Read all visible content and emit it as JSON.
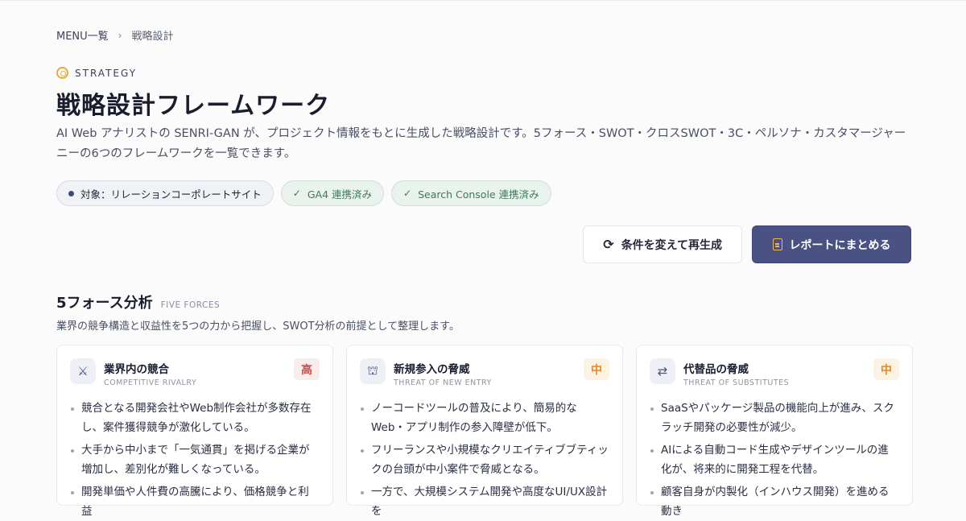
{
  "breadcrumb": {
    "parent": "MENU一覧",
    "separator": "›",
    "current": "戦略設計"
  },
  "eyebrow": {
    "label": "STRATEGY",
    "icon": "target-icon"
  },
  "header": {
    "title": "戦略設計フレームワーク",
    "description": "AI Web アナリストの SENRI-GAN が、プロジェクト情報をもとに生成した戦略設計です。5フォース・SWOT・クロスSWOT・3C・ペルソナ・カスタマージャーニーの6つのフレームワークを一覧できます。"
  },
  "chips": {
    "target": "対象：リレーションコーポレートサイト",
    "ga4": "GA4 連携済み",
    "search_console": "Search Console 連携済み",
    "check_glyph": "✓"
  },
  "actions": {
    "regenerate": {
      "label": "条件を変えて再生成",
      "icon": "refresh-icon",
      "glyph": "⟳"
    },
    "report": {
      "label": "レポートにまとめる",
      "icon": "document-icon"
    }
  },
  "section": {
    "title": "5フォース分析",
    "tag": "FIVE FORCES",
    "description": "業界の競争構造と収益性を5つの力から把握し、SWOT分析の前提として整理します。"
  },
  "cards": [
    {
      "title": "業界内の競合",
      "subtitle": "COMPETITIVE RIVALRY",
      "level": "高",
      "level_type": "high",
      "icon": "crossed-swords-icon",
      "glyph": "⚔",
      "bullets": [
        "競合となる開発会社やWeb制作会社が多数存在し、案件獲得競争が激化している。",
        "大手から中小まで「一気通貫」を掲げる企業が増加し、差別化が難しくなっている。",
        "開発単価や人件費の高騰により、価格競争と利益"
      ]
    },
    {
      "title": "新規参入の脅威",
      "subtitle": "THREAT OF NEW ENTRY",
      "level": "中",
      "level_type": "mid",
      "icon": "building-icon",
      "glyph": "⛫",
      "bullets": [
        "ノーコードツールの普及により、簡易的なWeb・アプリ制作の参入障壁が低下。",
        "フリーランスや小規模なクリエイティブブティックの台頭が中小案件で脅威となる。",
        "一方で、大規模システム開発や高度なUI/UX設計を"
      ]
    },
    {
      "title": "代替品の脅威",
      "subtitle": "THREAT OF SUBSTITUTES",
      "level": "中",
      "level_type": "mid",
      "icon": "swap-icon",
      "glyph": "⇄",
      "bullets": [
        "SaaSやパッケージ製品の機能向上が進み、スクラッチ開発の必要性が減少。",
        "AIによる自動コード生成やデザインツールの進化が、将来的に開発工程を代替。",
        "顧客自身が内製化（インハウス開発）を進める動き"
      ]
    }
  ],
  "colors": {
    "primary": "#4a5283",
    "accent": "#e8a93a",
    "success": "#3f7a5a",
    "level_high": "#cc4b4b",
    "level_mid": "#e08a22"
  }
}
